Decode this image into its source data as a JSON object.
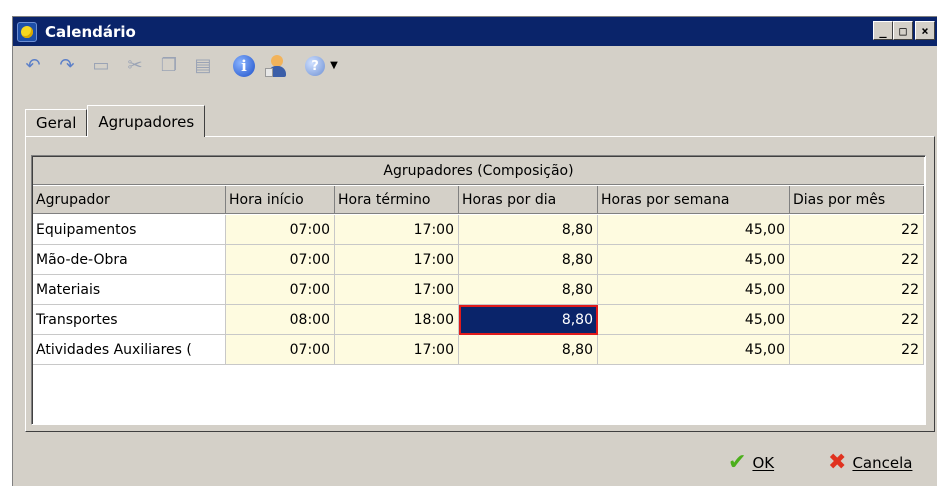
{
  "window": {
    "title": "Calendário",
    "controls": {
      "minimize": "_",
      "maximize": "□",
      "close": "×"
    }
  },
  "toolbar": {
    "icons": [
      "undo-icon",
      "redo-icon",
      "new-document-icon",
      "cut-icon",
      "copy-icon",
      "paste-icon",
      "info-icon",
      "user-icon",
      "help-icon"
    ]
  },
  "tabs": [
    {
      "label": "Geral",
      "active": false
    },
    {
      "label": "Agrupadores",
      "active": true
    }
  ],
  "grid": {
    "group_header": "Agrupadores (Composição)",
    "columns": [
      "Agrupador",
      "Hora início",
      "Hora término",
      "Horas por dia",
      "Horas por semana",
      "Dias por mês"
    ],
    "rows": [
      [
        "Equipamentos",
        "07:00",
        "17:00",
        "8,80",
        "45,00",
        "22"
      ],
      [
        "Mão-de-Obra",
        "07:00",
        "17:00",
        "8,80",
        "45,00",
        "22"
      ],
      [
        "Materiais",
        "07:00",
        "17:00",
        "8,80",
        "45,00",
        "22"
      ],
      [
        "Transportes",
        "08:00",
        "18:00",
        "8,80",
        "45,00",
        "22"
      ],
      [
        "Atividades Auxiliares (",
        "07:00",
        "17:00",
        "8,80",
        "45,00",
        "22"
      ]
    ],
    "selected_cell": {
      "row": 3,
      "col": 3
    }
  },
  "footer": {
    "ok_label": "OK",
    "cancel_label": "Cancela"
  },
  "colors": {
    "titlebar": "#0a246a",
    "selected_cell_bg": "#0a246a",
    "selected_cell_border": "#e01b1b",
    "number_cell_bg": "#fefbe0",
    "ok_icon": "#4caf1c",
    "cancel_icon": "#e0321f"
  }
}
